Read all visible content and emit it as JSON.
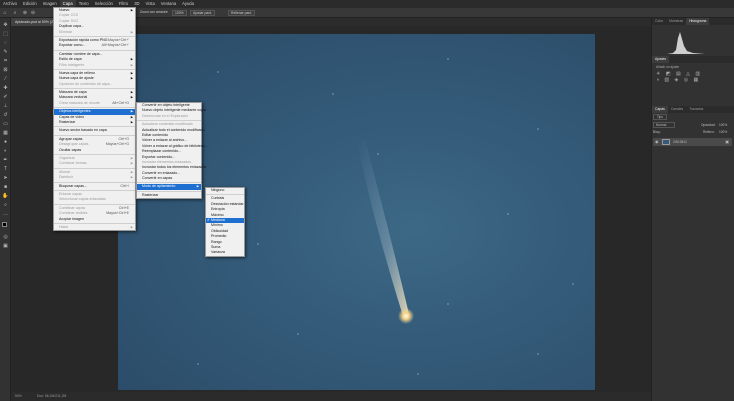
{
  "menubar": [
    "Archivo",
    "Edición",
    "Imagen",
    "Capa",
    "Texto",
    "Selección",
    "Filtro",
    "3D",
    "Vista",
    "Ventana",
    "Ayuda"
  ],
  "options": {
    "percent": "100%",
    "fit": "Ajustar pant.",
    "fill": "Rellenar pant.",
    "zoom": "Zoom con arrastre"
  },
  "doc": {
    "tab": "Aplanado.psd al 50% (ZW...)",
    "status": "50%",
    "doc_info": "Doc: 56,1M/211,2M"
  },
  "layer_menu": {
    "items": [
      {
        "label": "Nuevo",
        "arrow": true
      },
      {
        "label": "Copiar CSS",
        "dis": true
      },
      {
        "label": "Copiar SVG",
        "dis": true
      },
      {
        "label": "Duplicar capa..."
      },
      {
        "label": "Eliminar",
        "arrow": true,
        "dis": true
      },
      {
        "sep": true
      },
      {
        "label": "Exportación rápida como PNG",
        "sc": "Mayús+Ctrl+'"
      },
      {
        "label": "Exportar como...",
        "sc": "Alt+Mayús+Ctrl+'"
      },
      {
        "sep": true
      },
      {
        "label": "Cambiar nombre de capa..."
      },
      {
        "label": "Estilo de capa",
        "arrow": true
      },
      {
        "label": "Filtro inteligente",
        "arrow": true,
        "dis": true
      },
      {
        "sep": true
      },
      {
        "label": "Nueva capa de relleno",
        "arrow": true
      },
      {
        "label": "Nueva capa de ajuste",
        "arrow": true
      },
      {
        "label": "Opciones de contenido de capa...",
        "dis": true
      },
      {
        "sep": true
      },
      {
        "label": "Máscara de capa",
        "arrow": true
      },
      {
        "label": "Máscara vectorial",
        "arrow": true
      },
      {
        "label": "Crear máscara de recorte",
        "sc": "Alt+Ctrl+G",
        "dis": true
      },
      {
        "sep": true
      },
      {
        "label": "Objetos inteligentes",
        "arrow": true,
        "sel": true
      },
      {
        "label": "Capas de vídeo",
        "arrow": true
      },
      {
        "label": "Rasterizar",
        "arrow": true
      },
      {
        "sep": true
      },
      {
        "label": "Nuevo sector basado en capa"
      },
      {
        "sep": true
      },
      {
        "label": "Agrupar capas",
        "sc": "Ctrl+G"
      },
      {
        "label": "Desagrupar capas",
        "sc": "Mayús+Ctrl+G",
        "dis": true
      },
      {
        "label": "Ocultar capas"
      },
      {
        "sep": true
      },
      {
        "label": "Organizar",
        "arrow": true,
        "dis": true
      },
      {
        "label": "Combinar formas",
        "arrow": true,
        "dis": true
      },
      {
        "sep": true
      },
      {
        "label": "Alinear",
        "arrow": true,
        "dis": true
      },
      {
        "label": "Distribuir",
        "arrow": true,
        "dis": true
      },
      {
        "sep": true
      },
      {
        "label": "Bloquear capas...",
        "sc": "Ctrl+/"
      },
      {
        "sep": true
      },
      {
        "label": "Enlazar capas",
        "dis": true
      },
      {
        "label": "Seleccionar capas enlazadas",
        "dis": true
      },
      {
        "sep": true
      },
      {
        "label": "Combinar capas",
        "sc": "Ctrl+E",
        "dis": true
      },
      {
        "label": "Combinar visibles",
        "sc": "Mayús+Ctrl+E",
        "dis": true
      },
      {
        "label": "Acoplar imagen"
      },
      {
        "sep": true
      },
      {
        "label": "Halos",
        "arrow": true,
        "dis": true
      }
    ]
  },
  "smart_menu": {
    "items": [
      {
        "label": "Convertir en objeto inteligente"
      },
      {
        "label": "Nuevo objeto inteligente mediante copia"
      },
      {
        "label": "Desvincular en el Explorador",
        "dis": true
      },
      {
        "sep": true
      },
      {
        "label": "Actualizar contenido modificado",
        "dis": true
      },
      {
        "label": "Actualizar todo el contenido modificado"
      },
      {
        "label": "Editar contenido"
      },
      {
        "label": "Volver a enlazar al archivo..."
      },
      {
        "label": "Volver a enlazar al gráfico de biblioteca..."
      },
      {
        "label": "Reemplazar contenido..."
      },
      {
        "label": "Exportar contenido..."
      },
      {
        "label": "Incrustar elementos enlazados",
        "dis": true
      },
      {
        "label": "Incrustar todos los elementos enlazados"
      },
      {
        "label": "Convertir en enlazado..."
      },
      {
        "label": "Convertir en capas"
      },
      {
        "sep": true
      },
      {
        "label": "Modo de apilamiento",
        "arrow": true,
        "sel": true
      },
      {
        "sep": true
      },
      {
        "label": "Rasterizar"
      }
    ]
  },
  "stack_menu": {
    "items": [
      {
        "label": "Ninguno"
      },
      {
        "sep": true
      },
      {
        "label": "Curtosis"
      },
      {
        "label": "Desviación estándar"
      },
      {
        "label": "Entropía"
      },
      {
        "label": "Máximo"
      },
      {
        "label": "Mediana",
        "checked": true,
        "sel": true
      },
      {
        "label": "Mínimo"
      },
      {
        "label": "Oblicuidad"
      },
      {
        "label": "Promedio"
      },
      {
        "label": "Rango"
      },
      {
        "label": "Suma"
      },
      {
        "label": "Varianza"
      }
    ]
  },
  "panels": {
    "top_tabs": [
      "Color",
      "Muestras",
      "Histograma"
    ],
    "adjust_tabs": [
      "Ajustes"
    ],
    "adjust_label": "Añadir un ajuste",
    "layer_tabs": [
      "Capas",
      "Canales",
      "Trazados"
    ],
    "kind": "Tipo",
    "blend": "Normal",
    "opacity_label": "Opacidad:",
    "opacity": "100%",
    "fill_label": "Relleno:",
    "fill": "100%",
    "lock_label": "Bloq.:",
    "layer_name": "ZW13812"
  },
  "colors": {
    "highlight": "#1e6fd0",
    "photo": "#34597a"
  }
}
